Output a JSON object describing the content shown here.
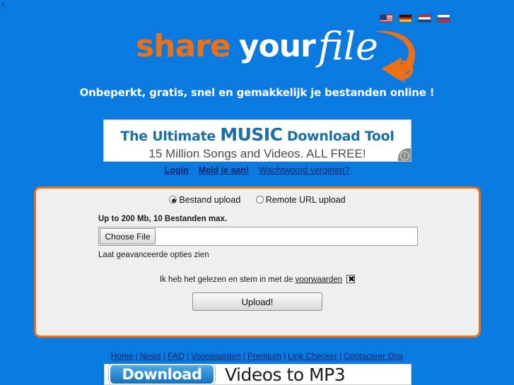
{
  "page": {
    "stray_char": "s",
    "background_color": "#0a7ae0",
    "accent_color": "#ee7014"
  },
  "language_bar": {
    "flags": [
      {
        "name": "flag-us",
        "label": "English"
      },
      {
        "name": "flag-de",
        "label": "Deutsch"
      },
      {
        "name": "flag-nl",
        "label": "Nederlands"
      },
      {
        "name": "flag-ru",
        "label": "Русский"
      }
    ]
  },
  "logo": {
    "word1": "share",
    "word2": "your",
    "word3": "file",
    "arrow_color": "#ee7014",
    "tagline": "Onbeperkt, gratis, snel en gemakkelijk je bestanden online !"
  },
  "ad_top": {
    "line1_pre": "The Ultimate ",
    "line1_big": "MUSIC",
    "line1_post": " Download Tool",
    "line2": "15 Million Songs and Videos. ALL FREE!",
    "info_glyph": "i"
  },
  "auth": {
    "login": "Login",
    "register": "Meld je aan!",
    "forgot": "Wachtwoord vergeten?"
  },
  "upload": {
    "radio_file": "Bestand upload",
    "radio_remote": "Remote URL upload",
    "radio_selected": "Bestand upload",
    "limit_text": "Up to 200 Mb, 10 Bestanden max.",
    "choose_file_label": "Choose File",
    "file_value": "",
    "advanced_link": "Laat geavanceerde opties zien",
    "terms_text": "Ik heb het gelezen en stem in met de ",
    "terms_link": "voorwaarden",
    "terms_checked": true,
    "upload_button": "Upload!"
  },
  "footer": {
    "links": [
      "Home",
      "News",
      "FAQ",
      "Voorwaarden",
      "Premium",
      "Link Checker",
      "Contacteer Ons"
    ],
    "separator": "|"
  },
  "ad_bottom": {
    "button_label": "Download",
    "text": "Videos to MP3"
  }
}
